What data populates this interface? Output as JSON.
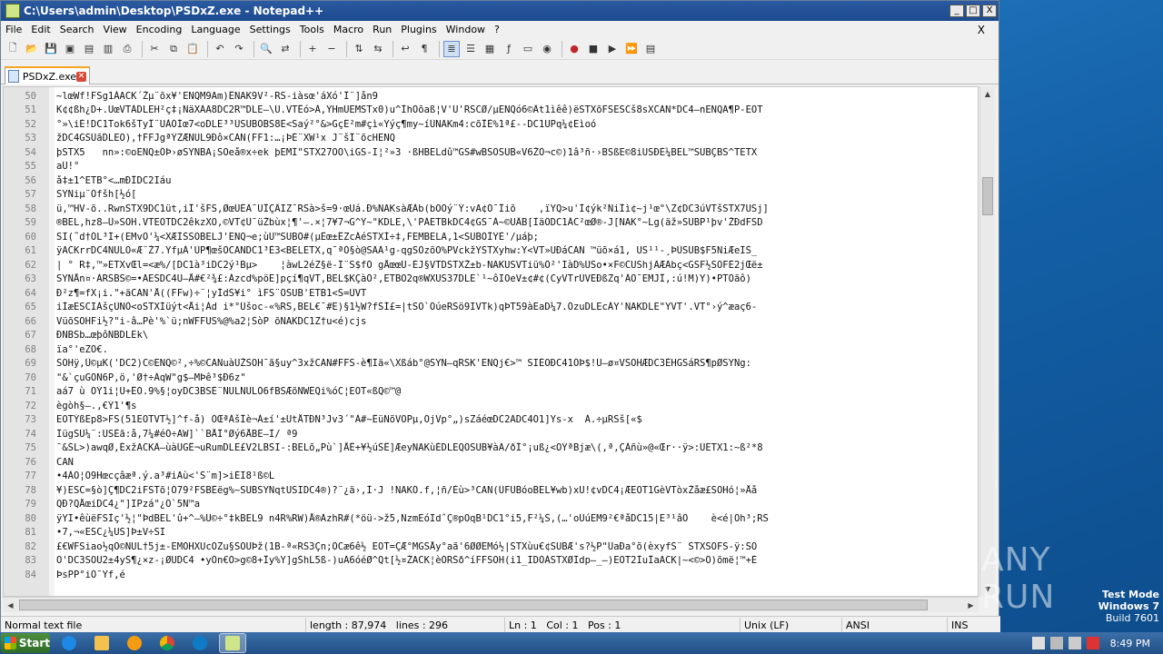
{
  "window": {
    "title": "C:\\Users\\admin\\Desktop\\PSDxZ.exe - Notepad++",
    "min": "_",
    "max": "□",
    "close": "X"
  },
  "menu": [
    "File",
    "Edit",
    "Search",
    "View",
    "Encoding",
    "Language",
    "Settings",
    "Tools",
    "Macro",
    "Run",
    "Plugins",
    "Window",
    "?"
  ],
  "menu_close": "X",
  "tab": {
    "label": "PSDxZ.exe"
  },
  "editor": {
    "lines": [
      {
        "n": "50",
        "t": "~lœWf!FSg1ÀACK´Žµ¨õx¥'ENQM9Am)ÊNAK9V²-RS-iàsœ'áXó'Î¨]ån9"
      },
      {
        "n": "51",
        "t": "K¢¢ßh¿D+.ÚœVTÀDLEH²ç‡¡ÑäXÄÄ8DC2R™DLE—\\Ü.VTÊó>À,ŸHmÜEMSTx0)u^ÌhÕõaß¦V'Ü'RSCØ/µENQó6©Ât1ìêê)ëSTXõFSESCš8sXCAN*DC4—nENQÄ¶P-EOT"
      },
      {
        "n": "52",
        "t": "°»\\iÈ!DC1Tok6šTyÎ¨UÀÓÍœ7<oDLE³³ÜSUBÕBS8Ë<Saý²°&>GçË²m#çì«Ÿýç¶my~íÜNAKm4:cõÎÈ%1ª£--DC1UPq¼¢Eìoó"
      },
      {
        "n": "53",
        "t": "žDC4GSÜãDLEÕ),†FFJgªÝZÆNUL9Ðô×CAN(FF1:…¡ÞÈ¨XW¹x J¨šÎ¨õcHENQ"
      },
      {
        "n": "54",
        "t": "þSTX5   nn»:©oENQ±ÒÞ›øSYNBA¡SOeå®x÷ek þEMÏ\"STX27OÕ\\iGS-I¦²»3 ·ßHBELdû™GS#wBSOSUB«V6ŽÓ¬c©)1â³ñ·›BSßE©8iUSÐÈ¼BEL™SUBÇBS^TETX"
      },
      {
        "n": "55",
        "t": "aÜ!°"
      },
      {
        "n": "56",
        "t": "å‡±1^ETB°<…mÐÎDC2Iáu"
      },
      {
        "n": "57",
        "t": "SYNiµ¨Öfšh[½ó["
      },
      {
        "n": "58",
        "t": "ü,™HV-õ..RwnSTX9DC1üt,iÎ'šFS,ØœÛÈÄ¯UÎÇÂIZ¯RSà>š=9·œUá.Ð%NAKsàÆÀb(bOÖý¨Ý:vA¢Ó¯Îiõ    ,ïYQ>u'Í¢ýk²NiÎì¢~j¹œ\"\\Z¢DC3úVTšSTX7USj]"
      },
      {
        "n": "59",
        "t": "®BEL,hz8—Û»SOH.VTEOTDC2êkzXÕ,©VT¢Ü¯üŽbùx¦¶'–.×¦7¥7¬G^Ÿ~\"KDLE,\\'PÁETBkDC4¢GS¯À~©UÂB[ÏäÖDC1ÀC²œØ®-J[NAK°~Lg(äž»SUBP¹þv'ŽÐdFSD"
      },
      {
        "n": "60",
        "t": "SI(˜d†ÓL³Ï+(EMvO'¼<XÆÌŠSOBELJ'ENQ¬e;ùU™SUBÕ#(µÈœ±ÊZcÁéSTXÍ÷‡,FEMBELA,1<SUBÓÎŸÈ'/µáþ;"
      },
      {
        "n": "61",
        "t": "ÿACKrrDC4NULO«Æ¨Ž7.ŸfµÀ'ÙP¶œšÕCANDC1³È3<BELETX,q¯ªÓ§ò@SÄÄ¹g-qgSOzõO%PVckžYSTXyhw:Y<VT»UÐáCAN ™üõ×á1, US¹¹-¸ÞÜSUB$F5NiÆeIŠ_"
      },
      {
        "n": "62",
        "t": "| ° R‡,™»ETXvŒl=<æ%/[DC1à³iDC2ý¹Bµ>    ¦àwL2éZ§ë-Ï¨S$fÓ gÅœœÜ-ÈJ§VTDSTXŽ±b-NAKUSVTiü%Ô²'IàD%ÜSo•×F©CUShjÄÆÄbç<GSF½SOFÈ2jŒë±"
      },
      {
        "n": "63",
        "t": "SYNÅn¤·ÀRSBS©=•ÃESDC4Ù—Å#€²¾£:Ázcd%pöE]pçí¶qVT,BEL$KÇàÖ²,ETBO2q®WXUS37DLE`¹~ôIOeV±¢#¢(CyVTrÙVEÐßZq'ÁÖ¯EMJÎ,:ú!M)Y)•PTÕãô)"
      },
      {
        "n": "64",
        "t": "Ð²z¶=fX¡i.\"+äCAN'Å((FFw)÷¨¦yÍdŠ¥i° ìFS¨ÕSUB'ETB1<S=ÙVT"
      },
      {
        "n": "65",
        "t": "iÍæESCIÀšçÜÑÒ<oSTXÍüýt<Åi¦Ád i*°Ûšoc-«%RS,BEL€¯#E)§1½W?fŠÍ£=|tSO`ÓúeRSö9IVTk)qÞT59àEaD¼7.ÓzuDLEcÀY'NAKDLE\"YVT'.VT°›ý^æaç6-"
      },
      {
        "n": "66",
        "t": "VüõSOHFi½?\"i-â…Pè'%`ü;nWFFUS%@%a2¦ŠòP õNAKDC1Z†u<é)cjs"
      },
      {
        "n": "67",
        "t": "ÐNBSb…œþôNBDLEk\\"
      },
      {
        "n": "68",
        "t": "ïa°'eZÕ€."
      },
      {
        "n": "69",
        "t": "SOHÿ,Ü©µK('DC2)C©ENQ©²,÷%©CANuàÜŽSOH¯ã§uy^3xžCAN#FFS-è¶Iä«\\Xßáb°@SYN–qRSK'ENQj€>™ SIÈOÐC41ÓÞ$!Ü—ø¤VSOHÆDC3ÈHGSáRS¶pØSYNg:"
      },
      {
        "n": "70",
        "t": "\"&`çuGÕÑ6P,ö,'Ø†÷ÀqW\"g$–MÞê³$Ð6z\""
      },
      {
        "n": "71",
        "t": "aá7 ù OÝ1i¦Ù+ÊÓ.9%§¦oyDC3BSÈ¨NULNULÖ6fBSÆõNWÉQi%óC¦EOT«ßQ©™@"
      },
      {
        "n": "72",
        "t": "ègòh§–.,€Ý1'¶s"
      },
      {
        "n": "73",
        "t": "EOTÝßEp8>FS(51EOTVT½]^f-å) ÓŒªÀšÎè¬Á±í'±ÛtÅTÐÑ³Jv3´\"À#~ÊüÑõVOPµ,ÕjVp°„)sZáéœDC2ÃDC4Ó1]Ys-x  À.÷µRSš[«$"
      },
      {
        "n": "74",
        "t": "ÎügSÙ¼¨:USÈã:å,7¼#éÓ÷AW]``BÅÎ°Øý6ÅBË—Ì/ ª9"
      },
      {
        "n": "75",
        "t": "¯&ŠL>)awqØ,ÈxžACKÂ—ùàÛGÊ¬uRumDLE£V2LBSI-:BELõ„Pù`]ÅÊ+¥½úŠÊ]ÆeyNAKùÉDLEQÔSUB¥àÄ/ðÌ°¡uß¿<OÝªBjæ\\(,ª,ÇÀñù»@«Œr··ÿ>:ÜETX1:~ß²*8"
      },
      {
        "n": "76",
        "t": "CAN"
      },
      {
        "n": "77",
        "t": "•4ÀO¦Ö9Hœcçâæª.ý.a³#iÃù<'Š¨m]>iÈÏ8¹ß©L"
      },
      {
        "n": "78",
        "t": "¥)ESC=§ò]Ç¶DC2iFSTõ¦Ó79²FSBÈëg%~SUBSYNqtUSIDC4®)?¨¿ä›,Ì·J !NAKÓ.f,¦ñ/Èù>³CAN(ÛFUBóoBEL¥wb)xU!¢vDC4¡ÆEOT1GèVTòxŽåæ£SOHó¦»Åå"
      },
      {
        "n": "79",
        "t": "QÐ?QÅœiDC4¿\"]IPzá\"¿Ô`5Ñ™a"
      },
      {
        "n": "80",
        "t": "ÿYI•êùëFSÌç'½¦\"ÞdBEL'û+^–%Ü©÷°‡kBEL9 n4R%RW)Å®ÄzhR#(*öü->ž5,ÑzmEóIdˆÇ®pOqB¹DC1°i5,F²¼Š,(…'oÚúEM9²€ªåDC15|E³¹âÔ    è<é|Õh³;RS"
      },
      {
        "n": "81",
        "t": "•7,¬«ESC¿¼US]Þ±V÷SI"
      },
      {
        "n": "82",
        "t": "£€WFSiao½qÕ©NUL†5j±-EMOHXUcÕZu§SOÜÞž(1B-ª«RS3Çn;ÖCæ6ê½ EOT=ÇÆ°MGSÅy°aã'6ØØEMó½|STXùu€¢SUBÆ's?½P\"ÛaÐa°õ(èxyfŠ¨ STXSOFS-ÿ:SO"
      },
      {
        "n": "83",
        "t": "Õ'DC3SOU2±4yŠ¶¿×z-¡ØUDC4 •yÓn€Ò>g©8+Îy%Y]gŠhL5ß-)uÄ6óéØ^Qt[½¤ŽACK¦èÓRŠð^íFFSOH(i1_IDÓÀSTXØÍdp—_–)EOT2ÌuÎaACK|~<©>Ö)õmë¦™+È"
      },
      {
        "n": "84",
        "t": "ÞsPP°iÖ¯Yf,é"
      }
    ]
  },
  "status": {
    "type": "Normal text file",
    "length": "length : 87,974",
    "lines": "lines : 296",
    "ln": "Ln : 1",
    "col": "Col : 1",
    "pos": "Pos : 1",
    "eol": "Unix (LF)",
    "encoding": "ANSI",
    "ins": "INS"
  },
  "taskbar": {
    "start": "Start",
    "clock": "8:49 PM"
  },
  "watermark": {
    "brand": "ANY RUN"
  },
  "testmode": {
    "line1": "Test Mode",
    "line2": "Windows 7",
    "line3": "Build 7601"
  }
}
